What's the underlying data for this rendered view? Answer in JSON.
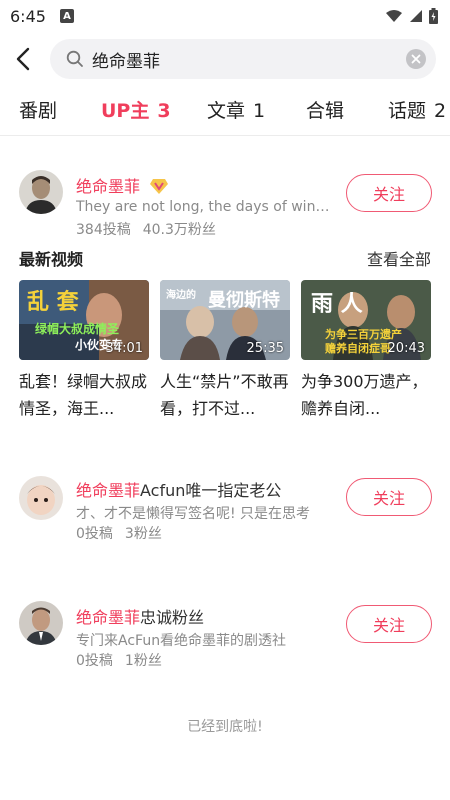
{
  "status": {
    "time": "6:45"
  },
  "search": {
    "query": "绝命墨菲"
  },
  "tabs": [
    {
      "label": "番剧",
      "count": ""
    },
    {
      "label": "UP主",
      "count": "3"
    },
    {
      "label": "文章",
      "count": "1"
    },
    {
      "label": "合辑",
      "count": ""
    },
    {
      "label": "话题",
      "count": "2"
    }
  ],
  "users": [
    {
      "name_highlight": "绝命墨菲",
      "name_rest": "",
      "signature": "They are not long, the days of wine a...",
      "posts": "384投稿",
      "fans": "40.3万粉丝",
      "follow_label": "关注"
    },
    {
      "name_highlight": "绝命墨菲",
      "name_rest": "Acfun唯一指定老公",
      "signature": "才、才不是懒得写签名呢! 只是在思考",
      "posts": "0投稿",
      "fans": "3粉丝",
      "follow_label": "关注"
    },
    {
      "name_highlight": "绝命墨菲",
      "name_rest": "忠诚粉丝",
      "signature": "专门来AcFun看绝命墨菲的剧透社",
      "posts": "0投稿",
      "fans": "1粉丝",
      "follow_label": "关注"
    }
  ],
  "latest": {
    "title": "最新视频",
    "see_all": "查看全部",
    "videos": [
      {
        "duration": "34:01",
        "title": "乱套！绿帽大叔成情圣，海王...",
        "overlay": "乱 套",
        "sub1": "绿帽大叔成情圣",
        "sub2": "小伙变专"
      },
      {
        "duration": "25:35",
        "title": "人生“禁片”不敢再看，打不过...",
        "overlay": "曼彻斯特",
        "sub1": "海边的",
        "sub2": ""
      },
      {
        "duration": "20:43",
        "title": "为争300万遗产，赡养自闭...",
        "overlay": "雨 人",
        "sub1": "为争三百万遗产",
        "sub2": "赡养自闭症哥"
      }
    ]
  },
  "footer": {
    "end_text": "已经到底啦!"
  },
  "colors": {
    "accent": "#f03e5c",
    "muted": "#8a8a8a"
  }
}
